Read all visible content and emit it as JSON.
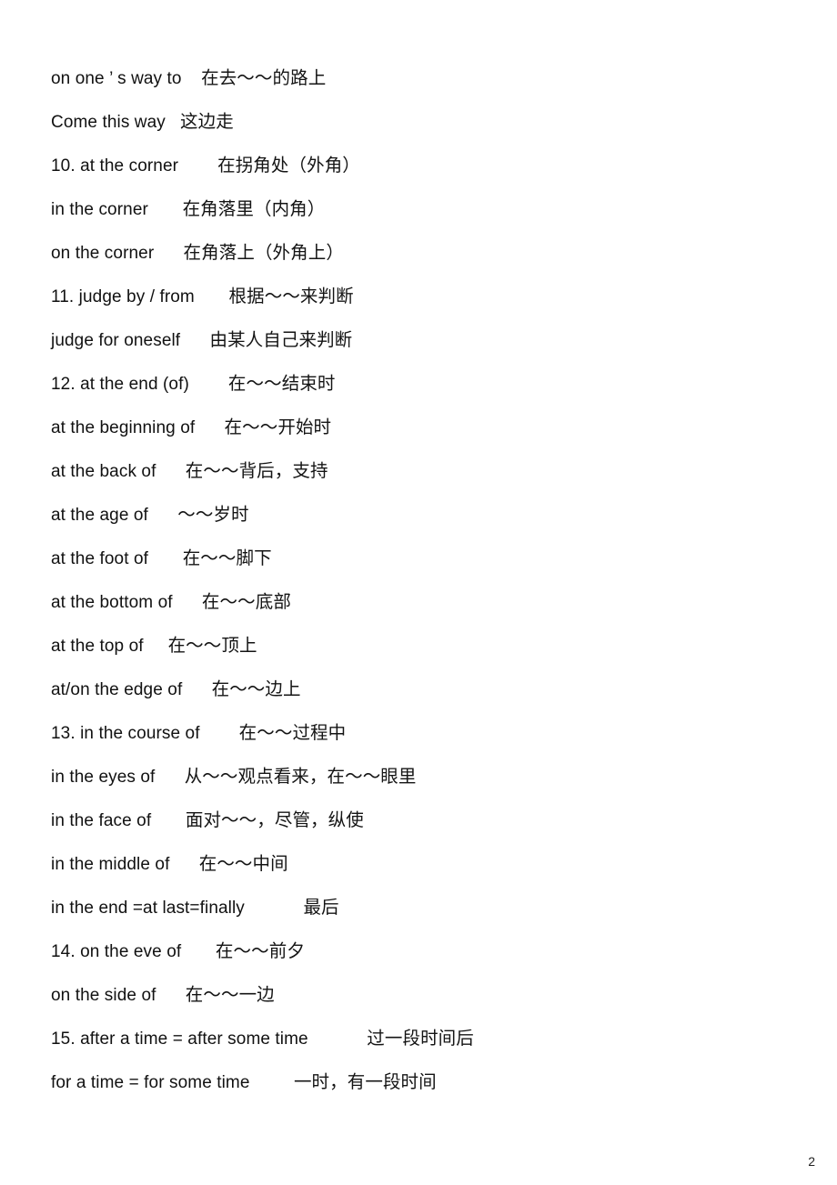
{
  "document": {
    "page_number": "2",
    "entries": [
      {
        "english": "on one ’ s way to",
        "gap": "    ",
        "chinese": "在去～～的路上"
      },
      {
        "english": "Come this way",
        "gap": "   ",
        "chinese": "这边走"
      },
      {
        "english": "10. at the corner",
        "gap": "        ",
        "chinese": "在拐角处（外角）"
      },
      {
        "english": "in the corner",
        "gap": "       ",
        "chinese": "在角落里（内角）"
      },
      {
        "english": "on the corner",
        "gap": "      ",
        "chinese": "在角落上（外角上）"
      },
      {
        "english": "11. judge by / from",
        "gap": "       ",
        "chinese": "根据～～来判断"
      },
      {
        "english": "judge for oneself",
        "gap": "      ",
        "chinese": "由某人自己来判断"
      },
      {
        "english": "12. at the end (of)",
        "gap": "        ",
        "chinese": "在～～结束时"
      },
      {
        "english": "at the beginning of",
        "gap": "      ",
        "chinese": "在～～开始时"
      },
      {
        "english": "at the back of",
        "gap": "      ",
        "chinese": "在～～背后，支持"
      },
      {
        "english": "at the age of",
        "gap": "      ",
        "chinese": "～～岁时"
      },
      {
        "english": "at the foot of",
        "gap": "       ",
        "chinese": "在～～脚下"
      },
      {
        "english": "at the bottom of",
        "gap": "      ",
        "chinese": "在～～底部"
      },
      {
        "english": "at the top of",
        "gap": "     ",
        "chinese": "在～～顶上"
      },
      {
        "english": "at/on the edge of",
        "gap": "      ",
        "chinese": "在～～边上"
      },
      {
        "english": "13. in the course of",
        "gap": "        ",
        "chinese": "在～～过程中"
      },
      {
        "english": "in the eyes of",
        "gap": "      ",
        "chinese": "从～～观点看来，在～～眼里"
      },
      {
        "english": "in the face of",
        "gap": "       ",
        "chinese": "面对～～，尽管，纵使"
      },
      {
        "english": "in the middle of",
        "gap": "      ",
        "chinese": "在～～中间"
      },
      {
        "english": "in the end =at last=finally",
        "gap": "            ",
        "chinese": "最后"
      },
      {
        "english": "14. on the eve of",
        "gap": "       ",
        "chinese": "在～～前夕"
      },
      {
        "english": "on the side of",
        "gap": "      ",
        "chinese": "在～～一边"
      },
      {
        "english": "15. after a time = after some time",
        "gap": "            ",
        "chinese": "过一段时间后"
      },
      {
        "english": "for a time = for some time",
        "gap": "         ",
        "chinese": "一时，有一段时间"
      }
    ]
  }
}
